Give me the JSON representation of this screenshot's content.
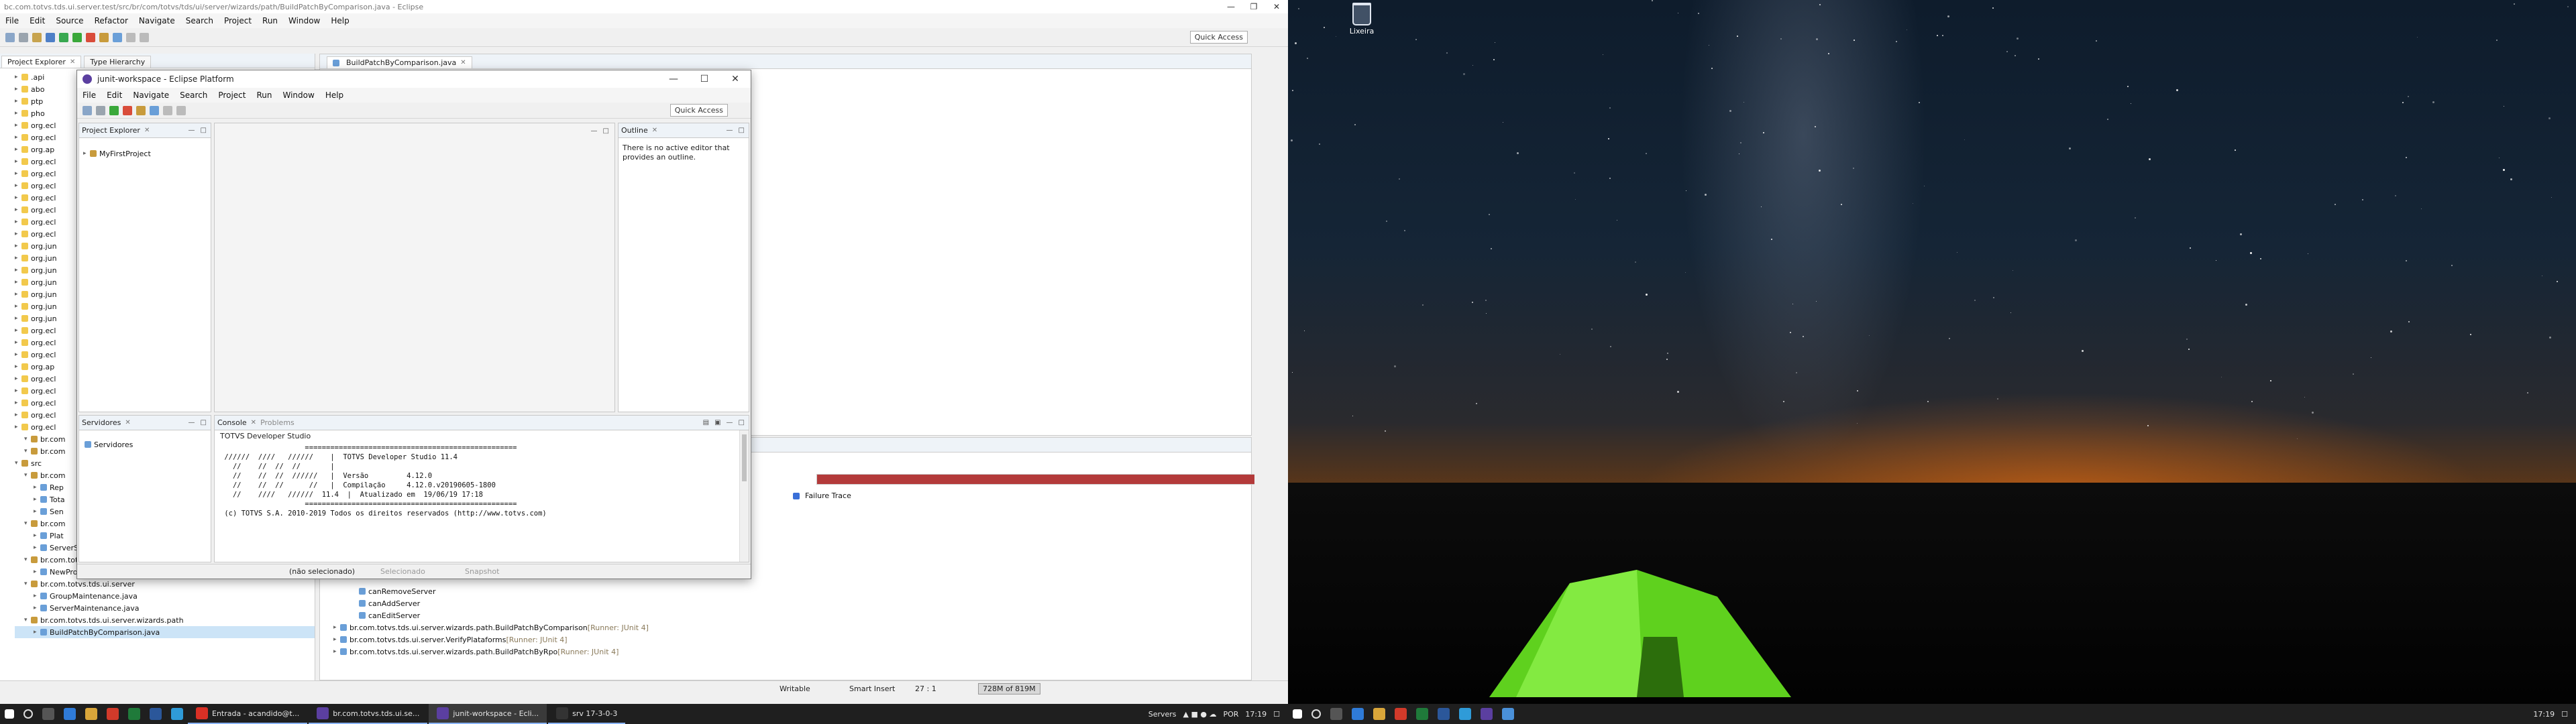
{
  "colors": {
    "accent": "#8ab4f8",
    "taskbar": "#1f1f1f",
    "tent_green": "#74e32a",
    "failure_bar": "#b33a3a"
  },
  "back_window": {
    "title": "bc.com.totvs.tds.ui.server.test/src/br/com/totvs/tds/ui/server/wizards/path/BuildPatchByComparison.java - Eclipse",
    "menu": [
      "File",
      "Edit",
      "Source",
      "Refactor",
      "Navigate",
      "Search",
      "Project",
      "Run",
      "Window",
      "Help"
    ],
    "quick_access": "Quick Access",
    "tabs": {
      "project_explorer": "Project Explorer",
      "type_hierarchy": "Type Hierarchy",
      "editor": "BuildPatchByComparison.java",
      "failure_trace": "Failure Trace"
    },
    "tree_top": [
      ".api",
      "abo",
      "ptp",
      "pho",
      "org.ecl",
      "org.ecl",
      "org.ap",
      "org.ecl",
      "org.ecl",
      "org.ecl",
      "org.ecl",
      "org.ecl",
      "org.ecl",
      "org.ecl",
      "org.jun",
      "org.jun",
      "org.jun",
      "org.jun",
      "org.jun",
      "org.jun",
      "org.jun",
      "org.ecl",
      "org.ecl",
      "org.ecl",
      "org.ap",
      "org.ecl",
      "org.ecl",
      "org.ecl",
      "org.ecl",
      "org.ecl"
    ],
    "tree_bottom": [
      {
        "label": "br.com",
        "kind": "pkg",
        "indent": 1
      },
      {
        "label": "br.com",
        "kind": "pkg",
        "indent": 1
      },
      {
        "label": "src",
        "kind": "pkg",
        "indent": 0
      },
      {
        "label": "br.com",
        "kind": "pkg",
        "indent": 1
      },
      {
        "label": "Rep",
        "kind": "java",
        "indent": 2
      },
      {
        "label": "Tota",
        "kind": "java",
        "indent": 2
      },
      {
        "label": "Sen",
        "kind": "java",
        "indent": 2
      },
      {
        "label": "br.com",
        "kind": "pkg",
        "indent": 1
      },
      {
        "label": "Plat",
        "kind": "java",
        "indent": 2
      },
      {
        "label": "ServerScenario.java",
        "kind": "java",
        "indent": 2
      },
      {
        "label": "br.com.totvs.tds.ui.sdk",
        "kind": "pkg",
        "indent": 1
      },
      {
        "label": "NewProtheusProject.java",
        "kind": "java",
        "indent": 2
      },
      {
        "label": "br.com.totvs.tds.ui.server",
        "kind": "pkg",
        "indent": 1
      },
      {
        "label": "GroupMaintenance.java",
        "kind": "java",
        "indent": 2
      },
      {
        "label": "ServerMaintenance.java",
        "kind": "java",
        "indent": 2
      },
      {
        "label": "br.com.totvs.tds.ui.server.wizards.path",
        "kind": "pkg",
        "indent": 1
      },
      {
        "label": "BuildPatchByComparison.java",
        "kind": "java",
        "indent": 2,
        "selected": true
      }
    ],
    "junit_runs": [
      {
        "label": "canRemoveServer",
        "sub": "",
        "indent": 2
      },
      {
        "label": "canAddServer",
        "sub": "",
        "indent": 2
      },
      {
        "label": "canEditServer",
        "sub": "",
        "indent": 2
      },
      {
        "label": "br.com.totvs.tds.ui.server.wizards.path.BuildPatchByComparison",
        "sub": "[Runner: JUnit 4]",
        "indent": 0
      },
      {
        "label": "br.com.totvs.tds.ui.server.VerifyPlataforms",
        "sub": "[Runner: JUnit 4]",
        "indent": 0
      },
      {
        "label": "br.com.totvs.tds.ui.server.wizards.path.BuildPatchByRpo",
        "sub": "[Runner: JUnit 4]",
        "indent": 0
      }
    ],
    "junit_progress": 1.0,
    "status": {
      "writable": "Writable",
      "insert": "Smart Insert",
      "position": "27 : 1",
      "heap": "728M of 819M"
    }
  },
  "front_window": {
    "title": "junit-workspace - Eclipse Platform",
    "menu": [
      "File",
      "Edit",
      "Navigate",
      "Search",
      "Project",
      "Run",
      "Window",
      "Help"
    ],
    "quick_access": "Quick Access",
    "project_explorer": {
      "tab": "Project Explorer",
      "items": [
        "MyFirstProject"
      ]
    },
    "outline": {
      "tab": "Outline",
      "message": "There is no active editor that provides an outline."
    },
    "servers": {
      "tab": "Servidores",
      "items": [
        "Servidores"
      ]
    },
    "console": {
      "tab": "Console",
      "tab2": "Problems",
      "header": "TOTVS Developer Studio",
      "lines": [
        "                    ==================================================",
        " //////  ////   //////    |  TOTVS Developer Studio 11.4",
        "   //    //  //  //       |",
        "   //    //  //  //////   |  Versão         4.12.0",
        "   //    //  //      //   |  Compilação     4.12.0.v20190605-1800",
        "   //    ////   //////  11.4  |  Atualizado em  19/06/19 17:18",
        "                    ==================================================",
        " (c) TOTVS S.A. 2010-2019 Todos os direitos reservados (http://www.totvs.com)"
      ]
    },
    "status": {
      "selection": "(não selecionado)",
      "item2": "Selecionado",
      "item3": "Snapshot"
    }
  },
  "taskbar_left": {
    "apps": [
      {
        "label": "Entrada - acandido@t...",
        "color": "#d93025"
      },
      {
        "label": "br.com.totvs.tds.ui.se...",
        "color": "#5b3fa0"
      },
      {
        "label": "junit-workspace - Ecli...",
        "color": "#5b3fa0",
        "active": true
      },
      {
        "label": "srv 17-3-0-3",
        "color": "#333"
      }
    ],
    "tray": {
      "servers": "Servers",
      "lang": "POR",
      "time": "17:19"
    }
  },
  "taskbar_right": {
    "time": "17:19"
  },
  "desktop": {
    "recycle_bin": "Lixeira"
  }
}
